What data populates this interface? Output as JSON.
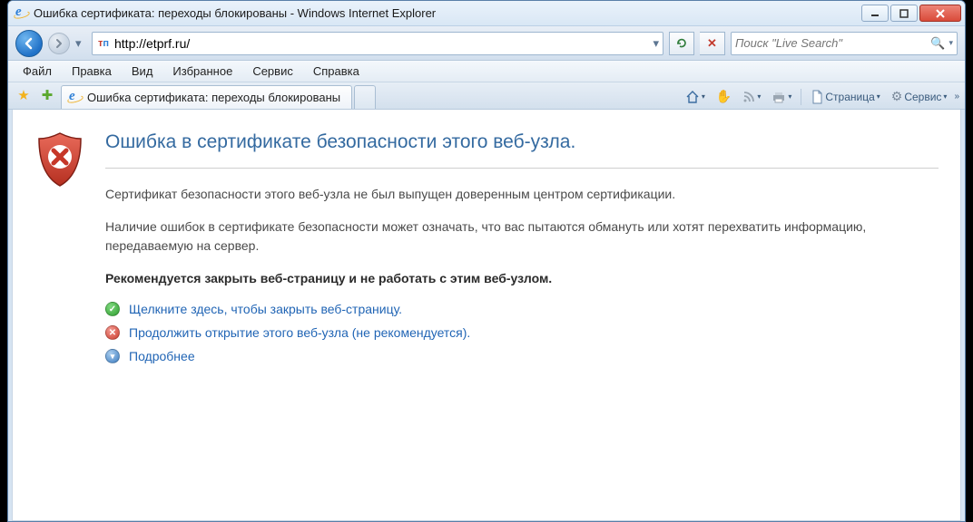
{
  "window": {
    "title": "Ошибка сертификата: переходы блокированы - Windows Internet Explorer"
  },
  "address": {
    "url": "http://etprf.ru/"
  },
  "search": {
    "placeholder": "Поиск \"Live Search\""
  },
  "menu": {
    "file": "Файл",
    "edit": "Правка",
    "view": "Вид",
    "favorites": "Избранное",
    "tools": "Сервис",
    "help": "Справка"
  },
  "tab": {
    "title": "Ошибка сертификата: переходы блокированы"
  },
  "commandbar": {
    "page": "Страница",
    "service": "Сервис"
  },
  "error": {
    "heading": "Ошибка в сертификате безопасности этого веб-узла.",
    "line1": "Сертификат безопасности этого веб-узла не был выпущен доверенным центром сертификации.",
    "line2": "Наличие ошибок в сертификате безопасности может означать, что вас пытаются обмануть или хотят перехватить информацию, передаваемую на сервер.",
    "recommend": "Рекомендуется закрыть веб-страницу и не работать с этим веб-узлом.",
    "close_link": "Щелкните здесь, чтобы закрыть веб-страницу.",
    "continue_link": "Продолжить открытие этого веб-узла (не рекомендуется).",
    "more": "Подробнее"
  }
}
